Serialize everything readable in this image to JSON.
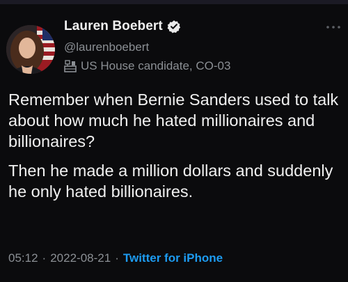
{
  "author": {
    "name": "Lauren Boebert",
    "handle": "@laurenboebert",
    "label": "US House candidate, CO-03",
    "verified": true
  },
  "tweet": {
    "paragraphs": [
      "Remember when Bernie Sanders used to talk about how much he hated millionaires and billionaires?",
      "Then he made a million dollars and suddenly he only hated billionaires."
    ]
  },
  "meta": {
    "time": "05:12",
    "date": "2022-08-21",
    "separator": "·",
    "source": "Twitter for iPhone"
  },
  "colors": {
    "background": "#0b0b0d",
    "text": "#f0f0f0",
    "secondary": "#8b8f94",
    "link": "#1d9bf0",
    "verified_badge": "#eaeaea"
  },
  "icons": {
    "verified": "verified-badge-icon",
    "label": "government-building-icon",
    "more": "more-options-icon"
  }
}
